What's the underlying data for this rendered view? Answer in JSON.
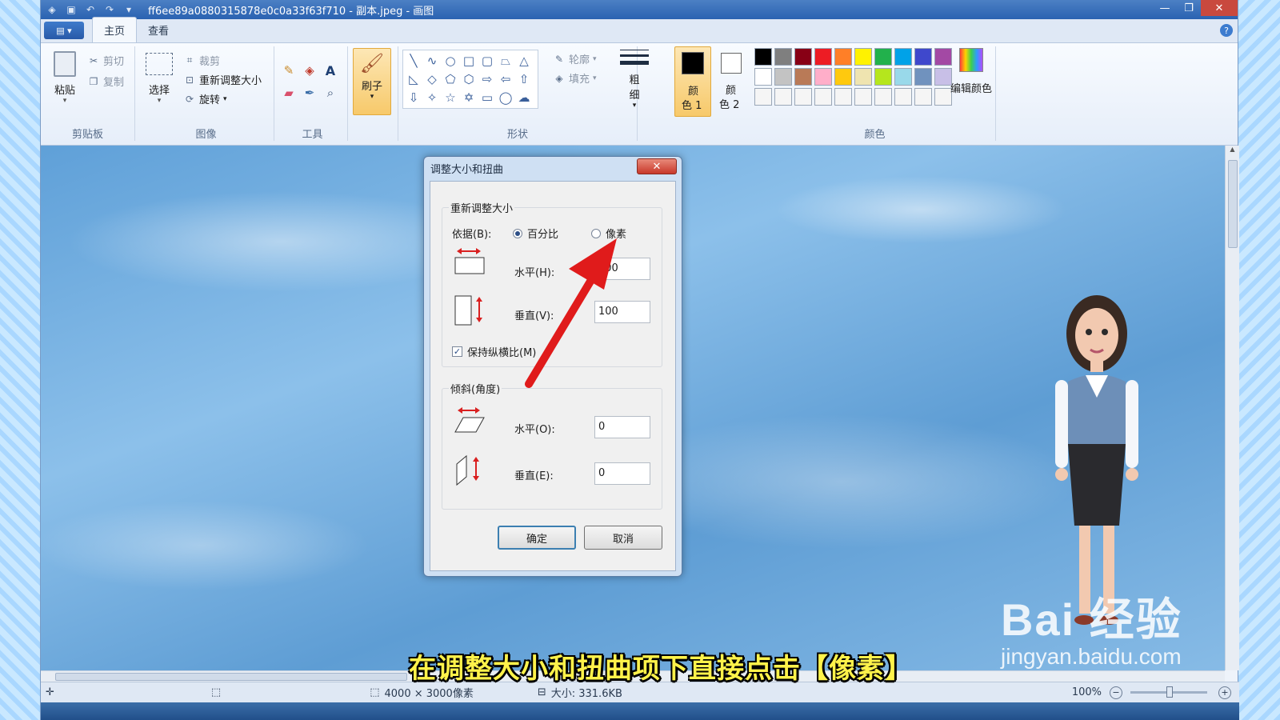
{
  "titlebar": {
    "title": "ff6ee89a0880315878e0c0a33f63f710 - 副本.jpeg - 画图",
    "minimize": "—",
    "maximize": "❐",
    "close": "✕"
  },
  "tabs": {
    "app_menu": "▤ ▾",
    "home": "主页",
    "view": "查看",
    "help": "?"
  },
  "ribbon": {
    "clipboard": {
      "paste": "粘贴",
      "cut": "剪切",
      "copy": "复制",
      "group": "剪贴板"
    },
    "image": {
      "select": "选择",
      "crop": "裁剪",
      "resize": "重新调整大小",
      "rotate": "旋转",
      "group": "图像"
    },
    "tools": {
      "group": "工具"
    },
    "brush": {
      "label": "刷子"
    },
    "shapes": {
      "outline": "轮廓",
      "fill": "填充",
      "group": "形状"
    },
    "size": {
      "label_1": "粗",
      "label_2": "细"
    },
    "colors": {
      "color1_a": "颜",
      "color1_b": "色 1",
      "color2_a": "颜",
      "color2_b": "色 2",
      "edit": "编辑颜色",
      "group": "颜色",
      "palette": [
        "#000000",
        "#7f7f7f",
        "#880015",
        "#ed1c24",
        "#ff7f27",
        "#fff200",
        "#22b14c",
        "#00a2e8",
        "#3f48cc",
        "#a349a4",
        "#ffffff",
        "#c3c3c3",
        "#b97a57",
        "#ffaec9",
        "#ffc90e",
        "#efe4b0",
        "#b5e61d",
        "#99d9ea",
        "#7092be",
        "#c8bfe7",
        "#f5f5f5",
        "#f5f5f5",
        "#f5f5f5",
        "#f5f5f5",
        "#f5f5f5",
        "#f5f5f5",
        "#f5f5f5",
        "#f5f5f5",
        "#f5f5f5",
        "#f5f5f5"
      ]
    }
  },
  "dialog": {
    "title": "调整大小和扭曲",
    "close": "✕",
    "resize_section": "重新调整大小",
    "by_label": "依据(B):",
    "opt_percent": "百分比",
    "opt_pixels": "像素",
    "horizontal_label": "水平(H):",
    "horizontal_value": "100",
    "vertical_label": "垂直(V):",
    "vertical_value": "100",
    "keep_ratio": "保持纵横比(M)",
    "skew_section": "倾斜(角度)",
    "skew_h_label": "水平(O):",
    "skew_h_value": "0",
    "skew_v_label": "垂直(E):",
    "skew_v_value": "0",
    "ok": "确定",
    "cancel": "取消"
  },
  "statusbar": {
    "dimensions": "4000 × 3000像素",
    "size": "大小: 331.6KB",
    "zoom": "100%",
    "zoom_out": "−",
    "zoom_in": "+"
  },
  "overlay": {
    "subtitle": "在调整大小和扭曲项下直接点击【像素】",
    "watermark_main": "Bai 经验",
    "watermark_url": "jingyan.baidu.com"
  }
}
